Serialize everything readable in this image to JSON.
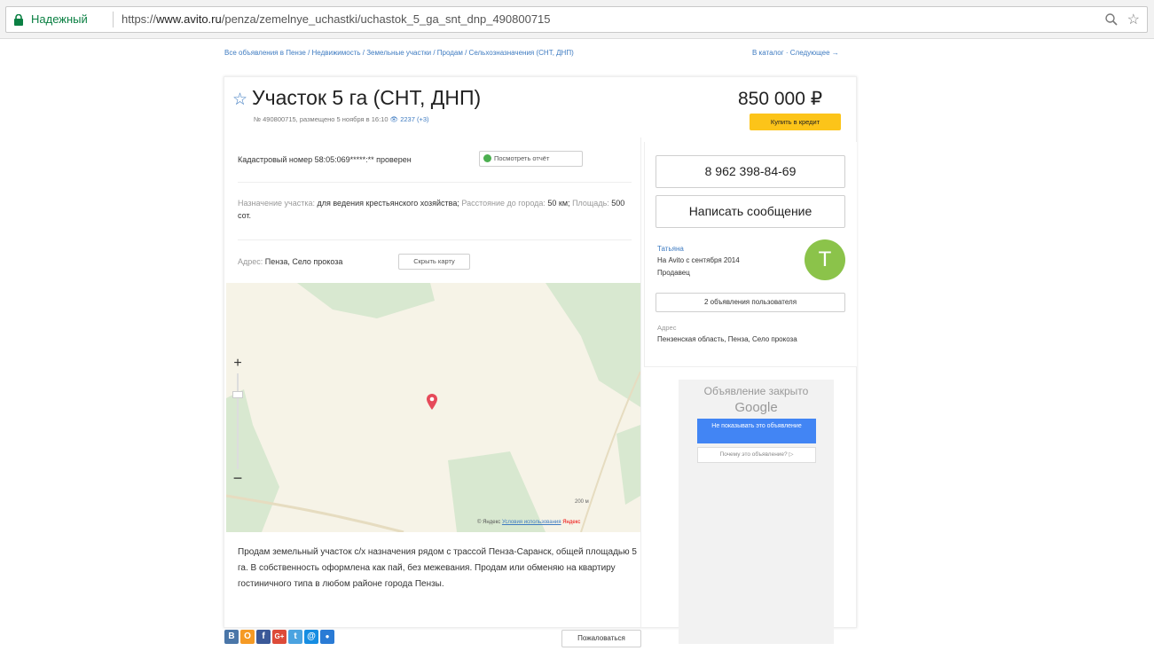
{
  "browser": {
    "secure_label": "Надежный",
    "url_prefix": "https://",
    "url_host": "www.avito.ru",
    "url_path": "/penza/zemelnye_uchastki/uchastok_5_ga_snt_dnp_490800715"
  },
  "breadcrumbs": "Все объявления в Пензе / Недвижимость / Земельные участки / Продам / Сельхозназначения (СНТ, ДНП)",
  "top_links": "В каталог · Следующее →",
  "listing": {
    "title": "Участок 5 га (СНТ, ДНП)",
    "meta": "№ 490800715, размещено 5 ноября в 16:10",
    "views": "2237 (+3)",
    "price": "850 000 ₽",
    "credit_label": "Купить в кредит"
  },
  "cadastral": {
    "text": "Кадастровый номер 58:05:069*****:** проверен",
    "report_label": "Посмотреть отчёт"
  },
  "params": {
    "purpose_label": "Назначение участка:",
    "purpose_value": "для ведения крестьянского хозяйства;",
    "distance_label": "Расстояние до города:",
    "distance_value": "50 км;",
    "area_label": "Площадь:",
    "area_value": "500 сот."
  },
  "address": {
    "label": "Адрес:",
    "value": "Пенза, Село прокоза",
    "hide_map_label": "Скрыть карту"
  },
  "map": {
    "zoom_in": "+",
    "zoom_out": "−",
    "scale_text": "200 м",
    "copyright": "© Яндекс",
    "terms": "Условия использования",
    "brand": "Яндекс"
  },
  "description": "Продам земельный участок с/х назначения рядом с трассой Пенза-Саранск, общей площадью 5 га. В собственность оформлена как пай, без межевания. Продам или обменяю на квартиру гостиничного типа в любом районе города Пензы.",
  "seller": {
    "phone": "8 962 398-84-69",
    "message_label": "Написать сообщение",
    "name": "Татьяна",
    "since": "На Avito с сентября 2014",
    "role": "Продавец",
    "avatar_letter": "T",
    "ads_label": "2 объявления пользователя",
    "address_label": "Адрес",
    "address": "Пензенская область, Пенза, Село прокоза"
  },
  "ad_block": {
    "closed_text": "Объявление закрыто",
    "google": "Google",
    "stop_label": "Не показывать это объявление",
    "why_label": "Почему это объявление? ▷"
  },
  "social": [
    {
      "letter": "В",
      "color": "#4a76a8"
    },
    {
      "letter": "О",
      "color": "#f59a24"
    },
    {
      "letter": "f",
      "color": "#3b5998"
    },
    {
      "letter": "G+",
      "color": "#dd4b39"
    },
    {
      "letter": "t",
      "color": "#4ba3e0"
    },
    {
      "letter": "@",
      "color": "#168de2"
    },
    {
      "letter": "●",
      "color": "#2a7bd5"
    }
  ],
  "complain_label": "Пожаловаться",
  "colors": {
    "link": "#3e7bc1",
    "credit": "#fcc419",
    "avatar": "#8bc34a",
    "secure": "#0b8043"
  }
}
